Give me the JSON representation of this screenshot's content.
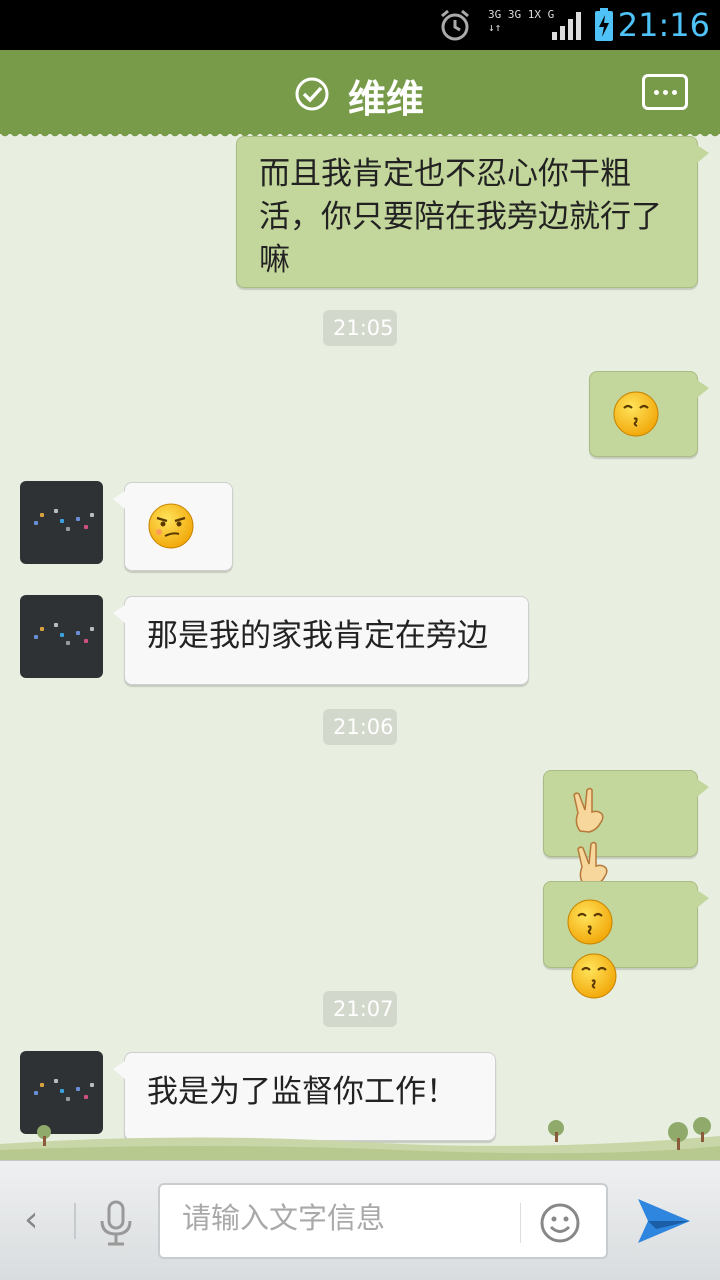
{
  "status_bar": {
    "time": "21:16",
    "net_line1": "3G 3G 1X G",
    "net_line2": "↓↑"
  },
  "header": {
    "title": "维维"
  },
  "messages": [
    {
      "side": "right",
      "text": "而且我肯定也不忍心你干粗活，你只要陪在我旁边就行了嘛"
    },
    {
      "timestamp": "21:05"
    },
    {
      "side": "right",
      "emoji": [
        "kiss-face"
      ]
    },
    {
      "side": "left",
      "emoji": [
        "smirk-face"
      ]
    },
    {
      "side": "left",
      "text": "那是我的家我肯定在旁边"
    },
    {
      "timestamp": "21:06"
    },
    {
      "side": "right",
      "emoji": [
        "victory-hand",
        "victory-hand"
      ]
    },
    {
      "side": "right",
      "emoji": [
        "kiss-face",
        "kiss-face"
      ]
    },
    {
      "timestamp": "21:07"
    },
    {
      "side": "left",
      "text": "我是为了监督你工作！"
    }
  ],
  "chat": {
    "m1": "而且我肯定也不忍心你干粗活，你只要陪在我旁边就行了嘛",
    "t1": "21:05",
    "m5": "那是我的家我肯定在旁边",
    "t2": "21:06",
    "t3": "21:07",
    "m10": "我是为了监督你工作！"
  },
  "input": {
    "placeholder": "请输入文字信息",
    "back_glyph": "‹"
  },
  "colors": {
    "header": "#789b4a",
    "chat_bg": "#e9efe0",
    "bubble_right": "#c3d69b",
    "bubble_left": "#f8f8f8",
    "send": "#2e86de"
  }
}
